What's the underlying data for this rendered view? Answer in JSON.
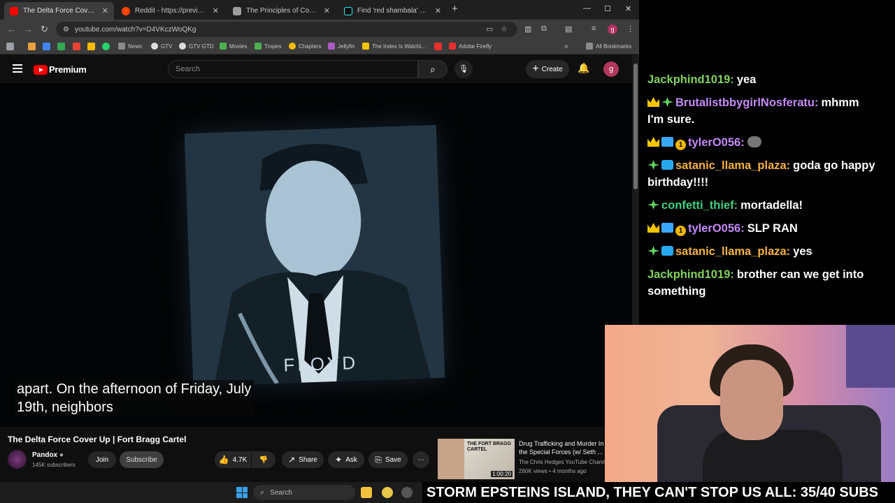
{
  "browser": {
    "tabs": [
      {
        "label": "The Delta Force Cover Up | Fort",
        "favicon_color": "#ff0000",
        "active": true
      },
      {
        "label": "Reddit - https://preview.redd.it/",
        "favicon_color": "#ff4500",
        "active": false
      },
      {
        "label": "The Principles of Communism",
        "favicon_color": "#9e9e9e",
        "active": false
      },
      {
        "label": "Find 'red shambala' on TikTok |",
        "favicon_color": "#25f4ee",
        "active": false
      }
    ],
    "url": "youtube.com/watch?v=D4VKczWoQKg",
    "bookmarks": [
      {
        "label": "News",
        "color": "#8a8a8a"
      },
      {
        "label": "GTV",
        "color": "#dddddd"
      },
      {
        "label": "GTV GTD",
        "color": "#dddddd"
      },
      {
        "label": "Movies",
        "color": "#4caf50"
      },
      {
        "label": "Tropes",
        "color": "#4caf50"
      },
      {
        "label": "Chapters",
        "color": "#fbbc04"
      },
      {
        "label": "Jellyfin",
        "color": "#aa5cc3"
      },
      {
        "label": "The Index Is Watchi...",
        "color": "#f5c400"
      },
      {
        "label": "Adobe Firefly",
        "color": "#e8312f"
      }
    ],
    "all_bookmarks_label": "All Bookmarks",
    "profile_initial": "g"
  },
  "youtube": {
    "brand": "Premium",
    "search_placeholder": "Search",
    "create_label": "Create",
    "avatar_initial": "g",
    "caption_line1": "apart. On the afternoon of Friday, July",
    "caption_line2": "19th, neighbors",
    "photo_name": "FLOYD",
    "title": "The Delta Force Cover Up | Fort Bragg Cartel",
    "channel": "Pandox",
    "subscribers": "145K subscribers",
    "join_label": "Join",
    "subscribe_label": "Subscribe",
    "likes": "4.7K",
    "share_label": "Share",
    "ask_label": "Ask",
    "save_label": "Save",
    "recommended": {
      "title": "Drug Trafficking and Murder In the Special Forces (w/ Seth ...",
      "channel": "The Chris Hedges YouTube Channel",
      "meta": "260K views • 4 months ago",
      "duration": "1:00:20",
      "thumb_text": "THE FORT BRAGG CARTEL"
    }
  },
  "chat": [
    {
      "badges": [],
      "user": "Jackphind1019:",
      "user_color": "#7fd35a",
      "text": "yea"
    },
    {
      "badges": [
        "crown",
        "sparkle"
      ],
      "user": "BrutalistbbygirlNosferatu:",
      "user_color": "#c58af9",
      "text": "mhmm I'm sure."
    },
    {
      "badges": [
        "crown",
        "grid",
        "num"
      ],
      "user": "tylerO056:",
      "user_color": "#c58af9",
      "text": "",
      "emote": true
    },
    {
      "badges": [
        "sparkle",
        "cube"
      ],
      "user": "satanic_llama_plaza:",
      "user_color": "#f5b342",
      "text": "goda go happy birthday!!!!"
    },
    {
      "badges": [
        "sparkle"
      ],
      "user": "confetti_thief:",
      "user_color": "#3fd17e",
      "text": "mortadella!"
    },
    {
      "badges": [
        "crown",
        "grid",
        "num"
      ],
      "user": "tylerO056:",
      "user_color": "#c58af9",
      "text": "SLP RAN"
    },
    {
      "badges": [
        "sparkle",
        "cube"
      ],
      "user": "satanic_llama_plaza:",
      "user_color": "#f5b342",
      "text": "yes"
    },
    {
      "badges": [],
      "user": "Jackphind1019:",
      "user_color": "#7fd35a",
      "text": "brother can we get into something"
    }
  ],
  "taskbar": {
    "search_label": "Search"
  },
  "ticker": "STORM EPSTEINS ISLAND, THEY CAN'T STOP US ALL: 35/40 SUBS"
}
